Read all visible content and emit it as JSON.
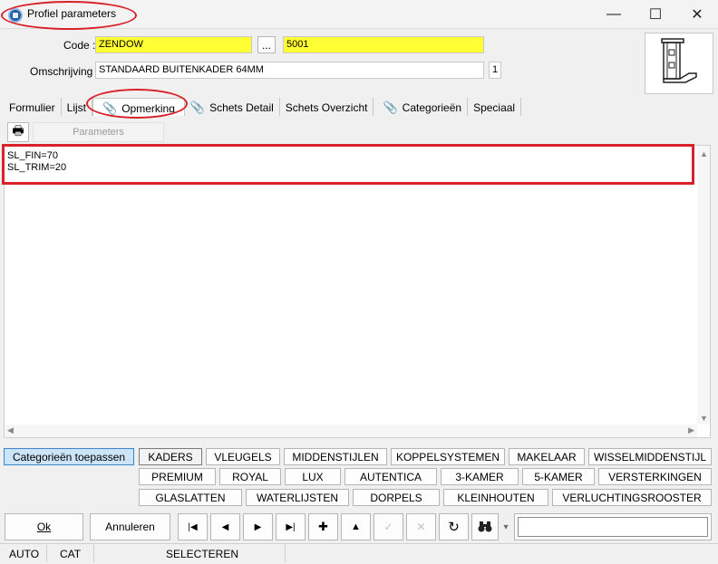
{
  "window": {
    "title": "Profiel parameters",
    "minimize": "—",
    "maximize": "☐",
    "close": "✕"
  },
  "form": {
    "code_label": "Code :",
    "code_value": "ZENDOW",
    "browse_label": "...",
    "code_id": "5001",
    "omschrijving_label": "Omschrijving :",
    "omschrijving_value": "STANDAARD BUITENKADER 64MM",
    "counter": "1"
  },
  "tabs": [
    "Formulier",
    "Lijst",
    "Opmerking",
    "Schets Detail",
    "Schets Overzicht",
    "Categorieën",
    "Speciaal"
  ],
  "subtoolbar": {
    "print_icon": "printer-icon",
    "parameters_label": "Parameters"
  },
  "memo": {
    "text": "SL_FIN=70\nSL_TRIM=20"
  },
  "categories": {
    "apply_label": "Categorieën toepassen",
    "row1": [
      "KADERS",
      "VLEUGELS",
      "MIDDENSTIJLEN",
      "KOPPELSYSTEMEN",
      "MAKELAAR",
      "WISSELMIDDENSTIJL"
    ],
    "row2": [
      "PREMIUM",
      "ROYAL",
      "LUX",
      "AUTENTICA",
      "3-KAMER",
      "5-KAMER",
      "VERSTERKINGEN"
    ],
    "row3": [
      "GLASLATTEN",
      "WATERLIJSTEN",
      "DORPELS",
      "KLEINHOUTEN",
      "VERLUCHTINGSROOSTER"
    ]
  },
  "navbar": {
    "ok_label": "Ok",
    "cancel_label": "Annuleren",
    "first": "|◀",
    "prev": "◀",
    "next": "▶",
    "last": "▶|",
    "add": "✚",
    "up": "▲",
    "confirm": "✓",
    "discard": "✕",
    "refresh": "↻",
    "find": "binoculars-icon",
    "dropdown": "▾",
    "search_value": ""
  },
  "status": {
    "cell1": "AUTO",
    "cell2": "CAT",
    "cell3": "SELECTEREN"
  },
  "colors": {
    "annotation": "#d8212a",
    "highlight": "#ffff33",
    "accent": "#3f86c8"
  }
}
